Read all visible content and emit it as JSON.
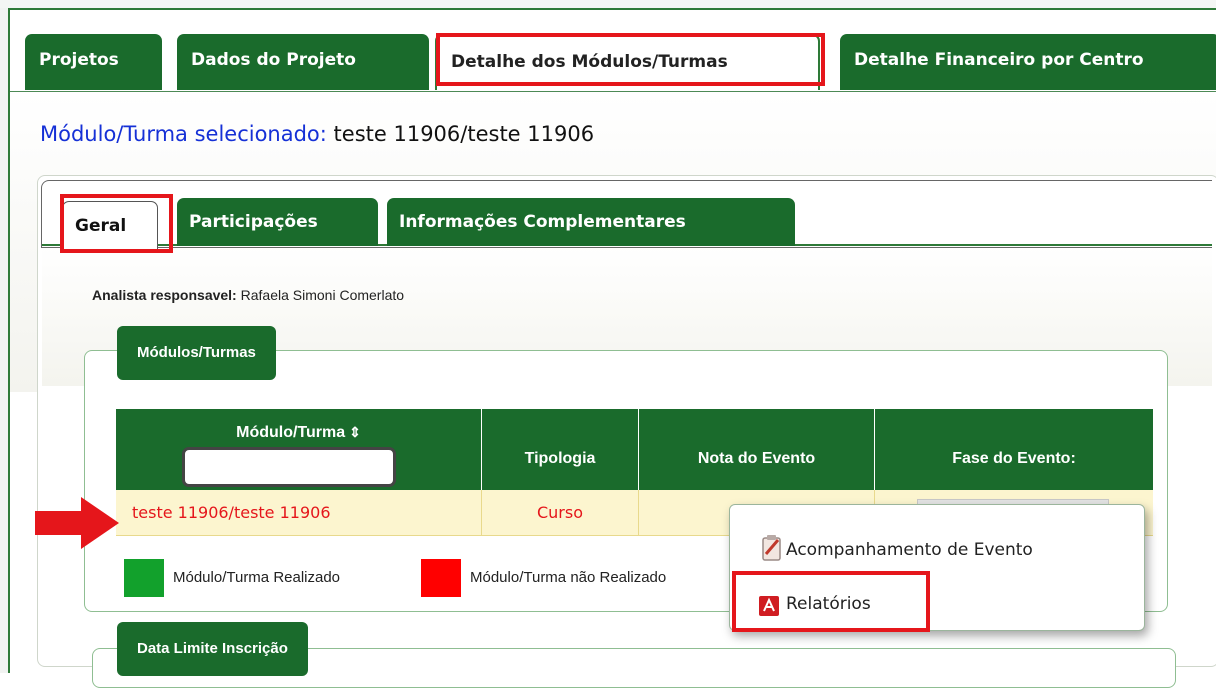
{
  "top_tabs": [
    {
      "label": "Projetos"
    },
    {
      "label": "Dados do Projeto"
    },
    {
      "label": "Detalhe dos Módulos/Turmas"
    },
    {
      "label": "Detalhe Financeiro por Centro"
    }
  ],
  "selected": {
    "label": "Módulo/Turma selecionado:",
    "value": "teste 11906/teste 11906"
  },
  "inner_tabs": [
    {
      "label": "Geral"
    },
    {
      "label": "Participações"
    },
    {
      "label": "Informações Complementares"
    }
  ],
  "analyst": {
    "label": "Analista responsavel:",
    "value": "Rafaela Simoni Comerlato"
  },
  "modulos_section": {
    "legend": "Módulos/Turmas",
    "columns": [
      "Módulo/Turma",
      "Tipologia",
      "Nota do Evento",
      "Fase do Evento:"
    ],
    "sort_icon": "⇕",
    "filter_value": "",
    "rows": [
      {
        "modulo": "teste 11906/teste 11906",
        "tipologia": "Curso"
      }
    ],
    "legend_items": [
      {
        "label": "Módulo/Turma Realizado",
        "color": "#12a12c"
      },
      {
        "label": "Módulo/Turma não Realizado",
        "color": "#ff0000"
      }
    ]
  },
  "data_limite_section": {
    "legend": "Data Limite Inscrição"
  },
  "context_menu": {
    "items": [
      {
        "label": "Acompanhamento de Evento",
        "icon": "clipboard-icon"
      },
      {
        "label": "Relatórios",
        "icon": "pdf-icon"
      }
    ]
  },
  "colors": {
    "accent_green": "#1a6b2c",
    "highlight_red": "#e5161b",
    "selected_row_bg": "#fcf5cf",
    "title_blue": "#1530d6"
  }
}
